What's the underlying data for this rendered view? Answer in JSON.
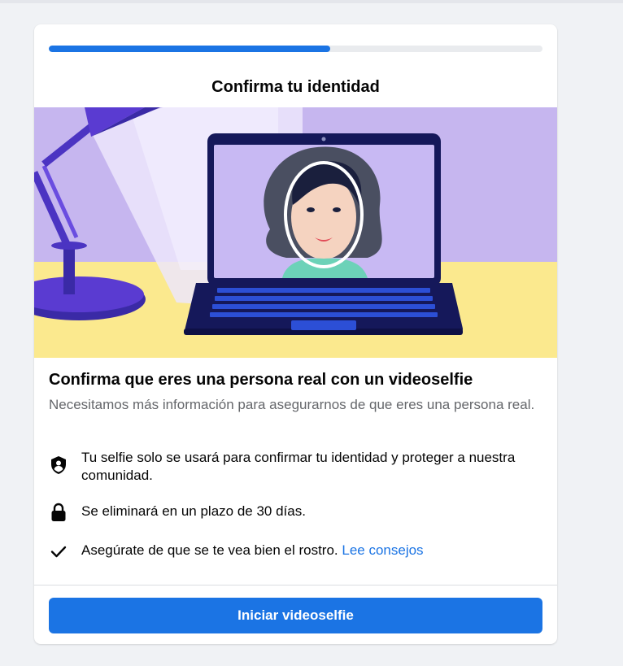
{
  "progress": {
    "fraction": 0.57
  },
  "card": {
    "title": "Confirma tu identidad",
    "headline": "Confirma que eres una persona real con un videoselfie",
    "subtitle": "Necesitamos más información para asegurarnos de que eres una persona real."
  },
  "items": [
    {
      "icon": "shield-person-icon",
      "text": "Tu selfie solo se usará para confirmar tu identidad y proteger a nuestra comunidad."
    },
    {
      "icon": "lock-icon",
      "text": "Se eliminará en un plazo de 30 días."
    },
    {
      "icon": "checkmark-icon",
      "text": "Asegúrate de que se te vea bien el rostro. ",
      "link": "Lee consejos"
    }
  ],
  "cta": {
    "label": "Iniciar videoselfie"
  },
  "colors": {
    "accent": "#1b74e4",
    "background": "#f0f2f5",
    "illustration_wall": "#c6b6ef",
    "illustration_desk": "#fbe98e",
    "illustration_navy": "#15185a"
  }
}
